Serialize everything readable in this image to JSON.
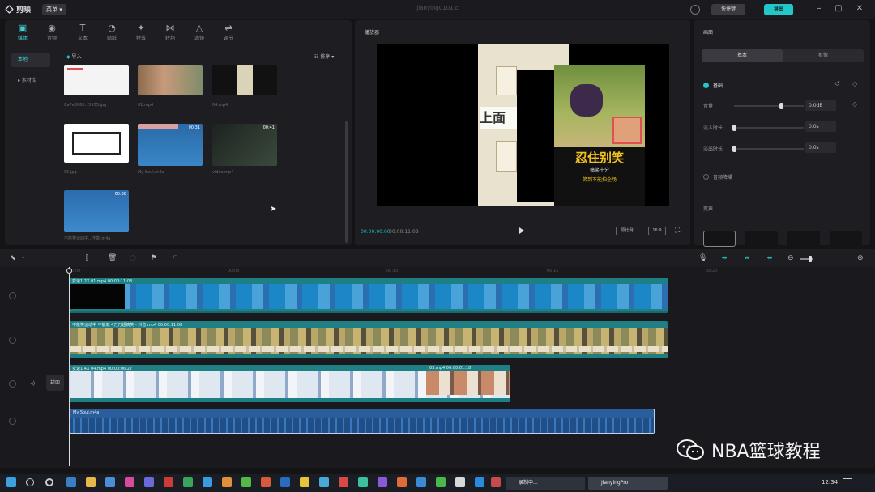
{
  "titlebar": {
    "app_name": "剪映",
    "menu": "菜单",
    "doc_title": "jianying0101.c",
    "shortcut": "快捷键",
    "export": "导出"
  },
  "media": {
    "tabs": [
      {
        "label": "媒体",
        "icon": "media-icon"
      },
      {
        "label": "音频",
        "icon": "audio-icon"
      },
      {
        "label": "文本",
        "icon": "text-icon"
      },
      {
        "label": "贴纸",
        "icon": "sticker-icon"
      },
      {
        "label": "特效",
        "icon": "effects-icon"
      },
      {
        "label": "转场",
        "icon": "transition-icon"
      },
      {
        "label": "滤镜",
        "icon": "filter-icon"
      },
      {
        "label": "调节",
        "icon": "adjust-icon"
      }
    ],
    "side": [
      "本地",
      "素材库"
    ],
    "import": "导入",
    "sort": "排序",
    "items": [
      {
        "name": "Ca7e8066...5555.jpg",
        "duration": ""
      },
      {
        "name": "01.mp4",
        "duration": ""
      },
      {
        "name": "04.mp4",
        "duration": ""
      },
      {
        "name": "05.jpg",
        "duration": ""
      },
      {
        "name": "My Soul.m4a",
        "duration": "00:31"
      },
      {
        "name": "video.mp4",
        "duration": "00:41"
      },
      {
        "name": "不能笑运动中...不能.m4a",
        "duration": "00:38"
      }
    ]
  },
  "player": {
    "title": "播放器",
    "time_current": "00:00:00:00",
    "time_total": "00:00:11:08",
    "ratio": "原比例",
    "aspect": "16:9",
    "overlay_top": "上面",
    "headline": "忍住别笑",
    "sub1": "搞笑十分",
    "sub2": "笑到不能拍全场"
  },
  "props": {
    "title": "画面",
    "tab_basic": "基本",
    "tab_other": "抠像",
    "section_mix": "基础",
    "rows": [
      {
        "label": "音量",
        "value": "0.0dB"
      },
      {
        "label": "淡入时长",
        "value": "0.0s"
      },
      {
        "label": "淡出时长",
        "value": "0.0s"
      }
    ],
    "denoise": "音频降噪",
    "speed": "变声"
  },
  "timeline": {
    "ruler_marks": [
      "00:00",
      "00:05",
      "00:10",
      "00:15",
      "00:20"
    ],
    "tracks": [
      {
        "label": "变速1.2X  01.mp4  00:00:11:08"
      },
      {
        "label": "不能笑运动中 不能做 4万万超搞笑 - 抖音.mp4  00:00:11:08"
      },
      {
        "label": "变速1.4X  04.mp4  00:00:06:27",
        "label2": "03.mp4  00:00:01:18"
      },
      {
        "label": "My Soul.m4a"
      }
    ],
    "cover": "封面"
  },
  "taskbar": {
    "app1": "录制中...",
    "app2": "JianyingPro",
    "clock": "12:34"
  },
  "watermark": "NBA篮球教程",
  "colors": {
    "accent": "#22c7c7",
    "panel": "#1e1e22",
    "bg": "#141417",
    "clip_teal": "#1e7f85",
    "audio": "#2a5d9c"
  }
}
